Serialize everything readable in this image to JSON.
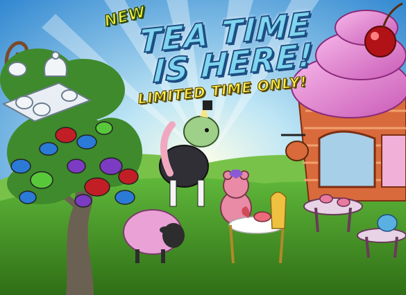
{
  "promo": {
    "badge": "NEW",
    "headline_line1": "TEA TIME",
    "headline_line2": "IS HERE!",
    "subheadline": "LIMITED TIME ONLY!"
  },
  "colors": {
    "sky_top": "#4aa3e0",
    "sky_bottom": "#bfe6f5",
    "grass": "#4e9a2a",
    "headline_fill": "#7fd4ee",
    "headline_outline": "#1c4e84",
    "subheadline_fill": "#fff24a",
    "badge_fill": "#f7ef3a",
    "frosting": "#e98ad0",
    "cupcake_house": "#d86a3c"
  },
  "scene_items": [
    "teacup-tree",
    "tea-set-tray",
    "unicorn-pony",
    "pink-sheep",
    "teddy-bear-at-table",
    "cupcake-tea-house",
    "cafe-table-set"
  ]
}
